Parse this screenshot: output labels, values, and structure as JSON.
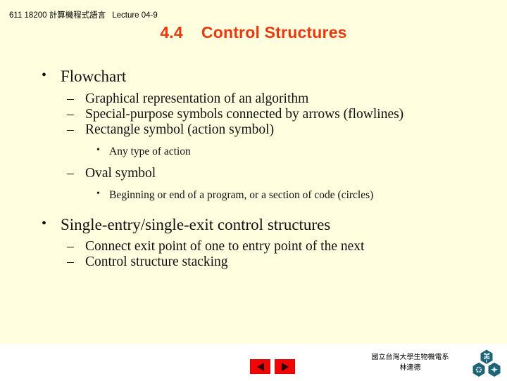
{
  "slide": {
    "title": {
      "number": "4.4",
      "text": "Control Structures"
    },
    "background_color": "#ffffe0",
    "title_color": "#e8380d",
    "body_color": "#111111",
    "bullets": [
      {
        "level": 1,
        "marker": "•",
        "text": "Flowchart"
      },
      {
        "level": 2,
        "marker": "–",
        "text": "Graphical representation of an algorithm"
      },
      {
        "level": 2,
        "marker": "–",
        "text": "Special-purpose symbols connected by arrows (flowlines)"
      },
      {
        "level": 2,
        "marker": "–",
        "text": "Rectangle symbol (action symbol)"
      },
      {
        "level": 3,
        "marker": "•",
        "text": "Any type of action"
      },
      {
        "level": 2,
        "marker": "–",
        "text": "Oval symbol"
      },
      {
        "level": 3,
        "marker": "•",
        "text": "Beginning or end of a program, or a section of code (circles)"
      },
      {
        "level": 1,
        "marker": "•",
        "text": "Single-entry/single-exit control structures"
      },
      {
        "level": 2,
        "marker": "–",
        "text": "Connect exit point of one to entry point of the next"
      },
      {
        "level": 2,
        "marker": "–",
        "text": "Control structure stacking"
      }
    ]
  },
  "footer": {
    "course_code": "611 18200 計算機程式語言",
    "lecture": "Lecture 04-9",
    "nav": {
      "prev_label": "previous-slide",
      "next_label": "next-slide",
      "button_color": "#f20505"
    },
    "department": "國立台灣大學生物機電系",
    "instructor": "林達德",
    "logo_name": "ntu-bime-logo",
    "logo_color": "#1f6475"
  }
}
